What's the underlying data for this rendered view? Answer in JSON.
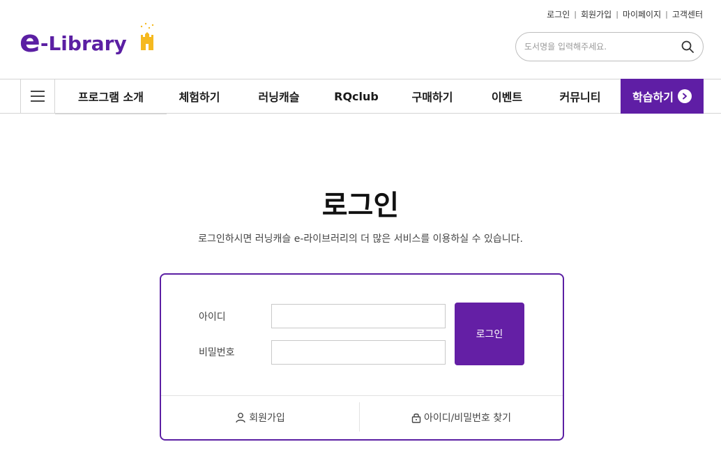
{
  "logo": {
    "e": "e",
    "text": "-Library"
  },
  "util_links": [
    "로그인",
    "회원가입",
    "마이페이지",
    "고객센터"
  ],
  "search": {
    "placeholder": "도서명을 입력해주세요."
  },
  "nav": {
    "items": [
      "프로그램 소개",
      "체험하기",
      "러닝캐슬",
      "RQclub",
      "구매하기",
      "이벤트",
      "커뮤니티"
    ],
    "study_label": "학습하기"
  },
  "page": {
    "title": "로그인",
    "subtitle": "로그인하시면 러닝캐슬 e-라이브러리의 더 많은 서비스를 이용하실 수 있습니다."
  },
  "login_form": {
    "id_label": "아이디",
    "password_label": "비밀번호",
    "id_value": "",
    "password_value": "",
    "login_button": "로그인",
    "signup_link": "회원가입",
    "find_link": "아이디/비밀번호 찾기"
  },
  "colors": {
    "brand": "#5f1ea5",
    "border": "#d4d4d4",
    "accent_star": "#f5b920"
  },
  "icons": {
    "menu": "hamburger-icon",
    "search": "search-icon",
    "arrow": "chevron-right-icon",
    "user": "user-icon",
    "lock": "lock-icon",
    "castle": "castle-icon"
  }
}
